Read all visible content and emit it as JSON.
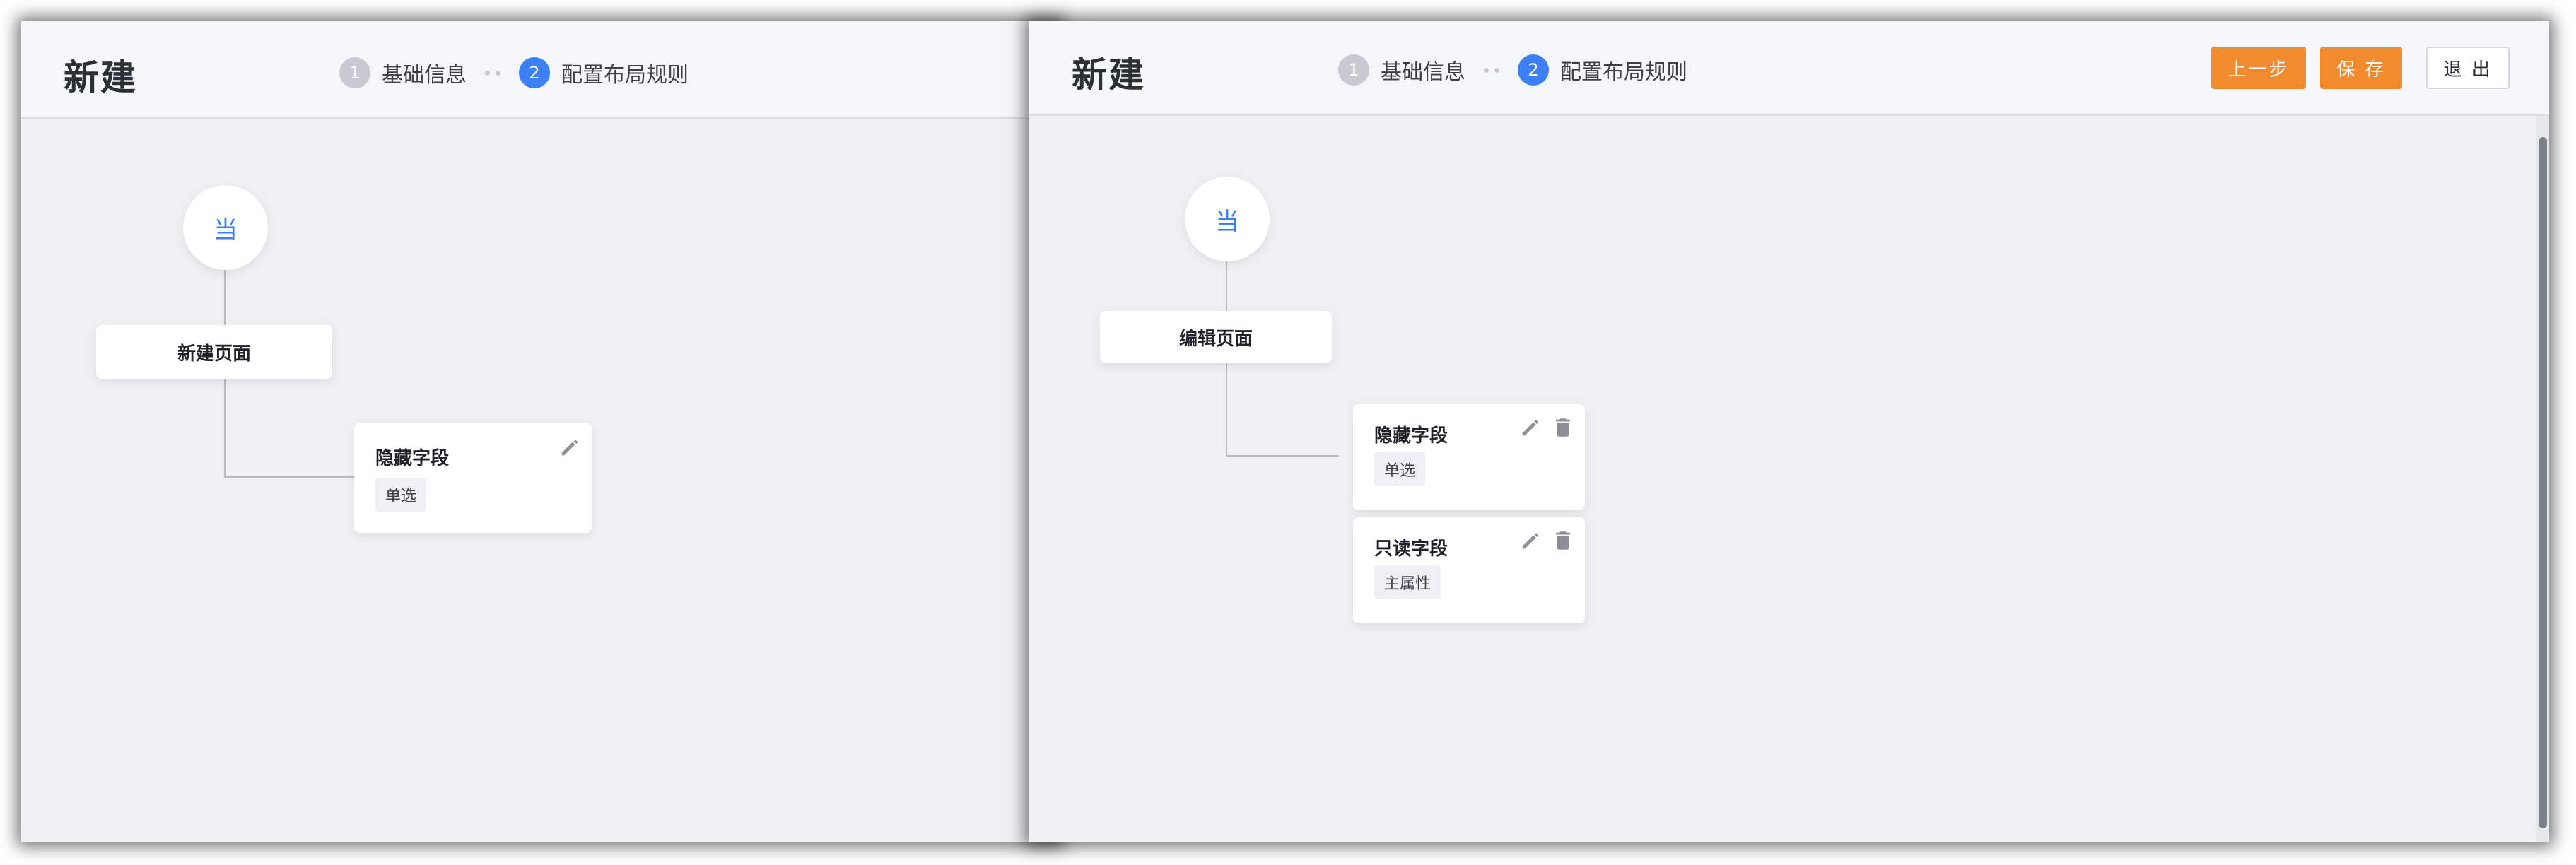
{
  "left": {
    "title": "新建",
    "steps": [
      {
        "num": "1",
        "label": "基础信息"
      },
      {
        "num": "2",
        "label": "配置布局规则"
      }
    ],
    "flow": {
      "root_label": "当",
      "page_node": "新建页面",
      "rules": [
        {
          "title": "隐藏字段",
          "tag": "单选",
          "icons": [
            "pencil-icon"
          ]
        }
      ]
    }
  },
  "right": {
    "title": "新建",
    "steps": [
      {
        "num": "1",
        "label": "基础信息"
      },
      {
        "num": "2",
        "label": "配置布局规则"
      }
    ],
    "buttons": {
      "prev": "上一步",
      "save": "保 存",
      "exit": "退 出"
    },
    "flow": {
      "root_label": "当",
      "page_node": "编辑页面",
      "rules": [
        {
          "title": "隐藏字段",
          "tag": "单选",
          "icons": [
            "pencil-icon",
            "trash-icon"
          ]
        },
        {
          "title": "只读字段",
          "tag": "主属性",
          "icons": [
            "pencil-icon",
            "trash-icon"
          ]
        }
      ]
    }
  },
  "colors": {
    "accent_blue": "#3d7ff6",
    "button_orange": "#f28a2e",
    "canvas": "#eff0f2",
    "step_inactive": "#c7cad1"
  }
}
